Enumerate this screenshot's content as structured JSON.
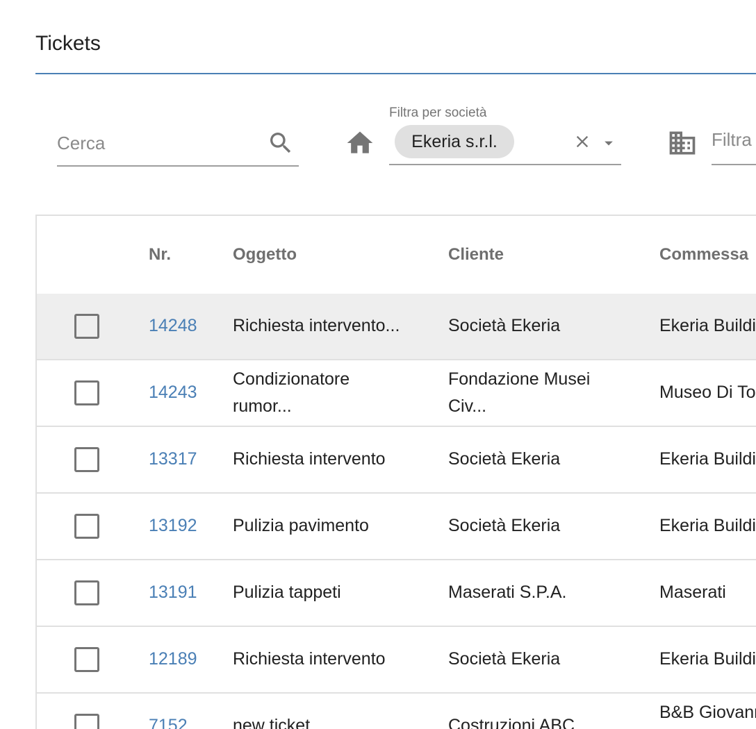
{
  "page": {
    "title": "Tickets"
  },
  "filters": {
    "search_placeholder": "Cerca",
    "company_label": "Filtra per società",
    "company_chip": "Ekeria s.r.l.",
    "building_placeholder": "Filtra"
  },
  "colors": {
    "accent": "#4a7fb5",
    "row_highlight": "#eeeeee",
    "chip": "#e0e0e0"
  },
  "icons": [
    "search-icon",
    "home-icon",
    "clear-icon",
    "dropdown-arrow-icon",
    "building-icon"
  ],
  "table": {
    "columns": [
      "Nr.",
      "Oggetto",
      "Cliente",
      "Commessa"
    ],
    "rows": [
      {
        "nr": "14248",
        "oggetto": "Richiesta intervento...",
        "cliente": "Società Ekeria",
        "commessa": "Ekeria Buildi"
      },
      {
        "nr": "14243",
        "oggetto_1": "Condizionatore",
        "oggetto_2": "rumor...",
        "cliente_1": "Fondazione Musei",
        "cliente_2": "Civ...",
        "commessa": "Museo Di To"
      },
      {
        "nr": "13317",
        "oggetto": "Richiesta intervento",
        "cliente": "Società Ekeria",
        "commessa": "Ekeria Buildi"
      },
      {
        "nr": "13192",
        "oggetto": "Pulizia pavimento",
        "cliente": "Società Ekeria",
        "commessa": "Ekeria Buildi"
      },
      {
        "nr": "13191",
        "oggetto": "Pulizia tappeti",
        "cliente": "Maserati S.P.A.",
        "commessa": "Maserati"
      },
      {
        "nr": "12189",
        "oggetto": "Richiesta intervento",
        "cliente": "Società Ekeria",
        "commessa": "Ekeria Buildi"
      },
      {
        "nr": "7152",
        "oggetto": "new ticket",
        "cliente": "Costruzioni ABC",
        "commessa": "B&B Giovann"
      }
    ]
  }
}
